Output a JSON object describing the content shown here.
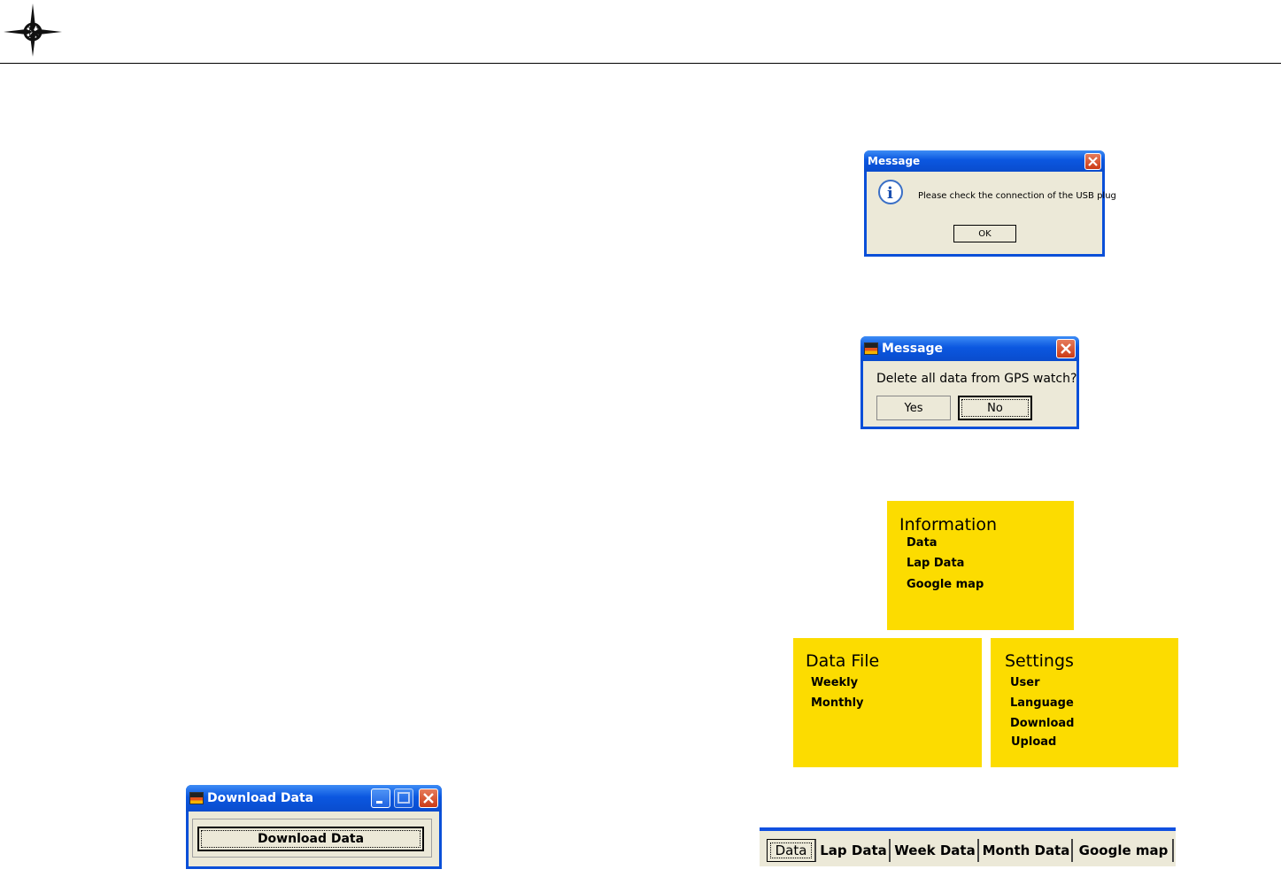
{
  "dialog_usb": {
    "title": "Message",
    "message": "Please check the connection of the USB plug",
    "ok_label": "OK",
    "icon": "info-icon"
  },
  "dialog_delete": {
    "title": "Message",
    "message": "Delete all data from GPS watch?",
    "yes_label": "Yes",
    "no_label": "No"
  },
  "menu_information": {
    "title": "Information",
    "items": [
      "Data",
      "Lap Data",
      "Google map"
    ]
  },
  "menu_datafile": {
    "title": "Data File",
    "items": [
      "Weekly",
      "Monthly"
    ]
  },
  "menu_settings": {
    "title": "Settings",
    "items": [
      "User",
      "Language",
      "Download",
      "Upload"
    ]
  },
  "download_window": {
    "title": "Download Data",
    "button_label": "Download Data"
  },
  "tabs": [
    "Data",
    "Lap Data",
    "Week Data",
    "Month Data",
    "Google map"
  ],
  "colors": {
    "accent": "#fcdc00",
    "titlebar": "#0a4fd8",
    "dialog_bg": "#ece9d8"
  }
}
